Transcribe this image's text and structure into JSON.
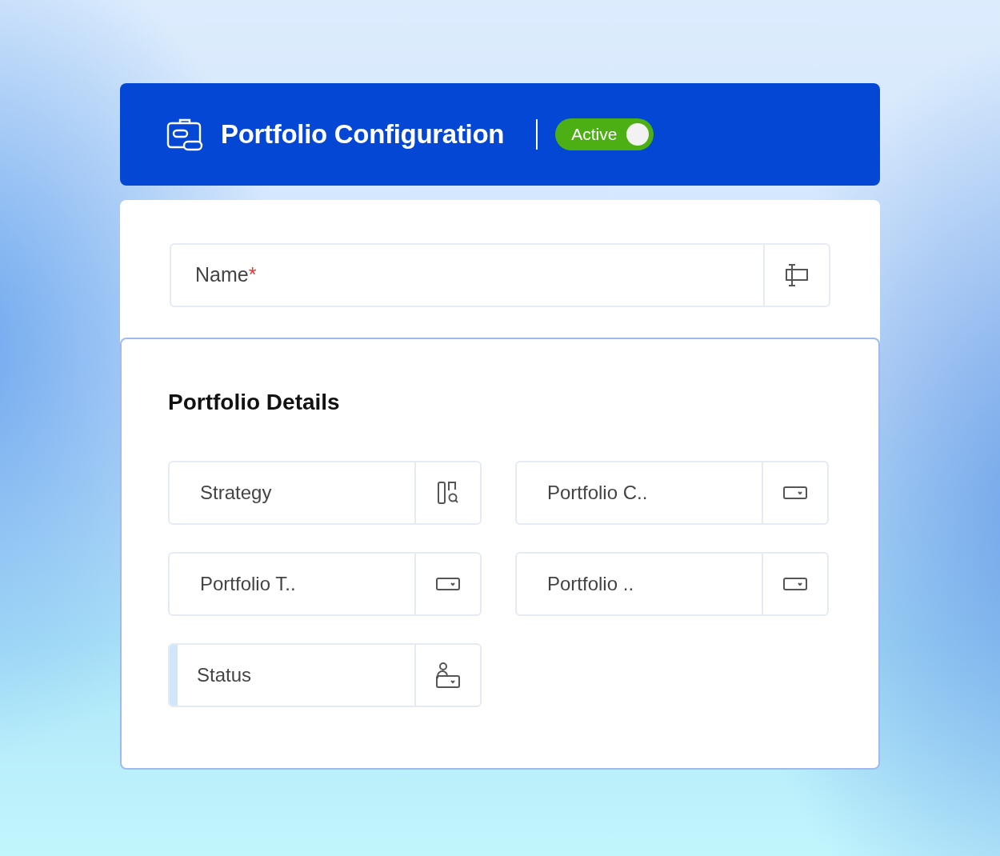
{
  "header": {
    "title": "Portfolio Configuration",
    "toggle_label": "Active",
    "active": true
  },
  "name_field": {
    "placeholder": "Name",
    "required_mark": "*",
    "kind": "text"
  },
  "details": {
    "title": "Portfolio Details",
    "fields": [
      {
        "placeholder": "Strategy",
        "kind": "lookup",
        "highlighted": false
      },
      {
        "placeholder": "Portfolio C..",
        "kind": "dropdown",
        "highlighted": false
      },
      {
        "placeholder": "Portfolio T..",
        "kind": "dropdown",
        "highlighted": false
      },
      {
        "placeholder": "Portfolio ..",
        "kind": "dropdown",
        "highlighted": false
      },
      {
        "placeholder": "Status",
        "kind": "user-dropdown",
        "highlighted": true
      }
    ]
  }
}
